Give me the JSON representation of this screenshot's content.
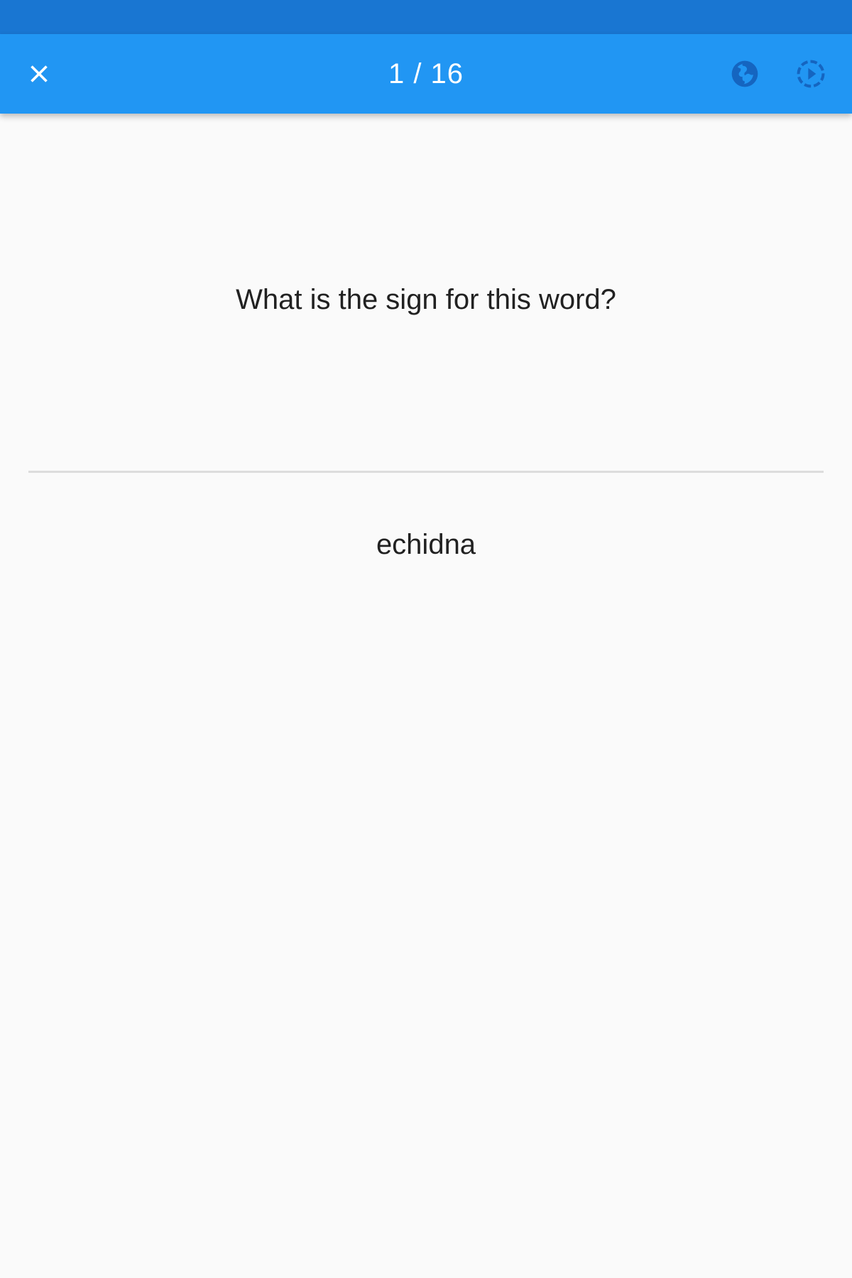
{
  "colors": {
    "status_bar": "#1976d2",
    "app_bar": "#2196f3",
    "background": "#fafafa",
    "text": "#212121",
    "divider": "#dcdcdc"
  },
  "app_bar": {
    "title": "1 / 16",
    "left_icon": "close-icon",
    "right_icons": [
      "globe-icon",
      "play-circle-icon"
    ]
  },
  "card": {
    "question": "What is the sign for this word?",
    "word": "echidna"
  }
}
